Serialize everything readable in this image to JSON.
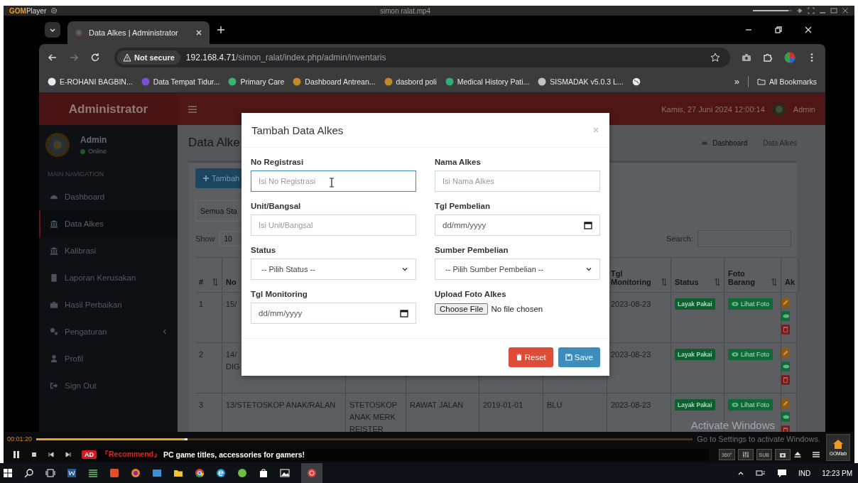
{
  "player": {
    "logo": "GOM",
    "name": "Player",
    "title": "simon ralat.mp4",
    "volume": {
      "level": 0.9
    }
  },
  "browser": {
    "tab_title": "Data Alkes | Administrator",
    "security": "Not secure",
    "host": "192.168.4.71",
    "path": "/simon_ralat/index.php/admin/inventaris",
    "bookmarks": [
      {
        "label": "E-ROHANI BAGBIN...",
        "color": "#e8eaed"
      },
      {
        "label": "Data Tempat Tidur...",
        "color": "#7b4fd6"
      },
      {
        "label": "Primary Care",
        "color": "#3cb371"
      },
      {
        "label": "Dashboard Antrean...",
        "color": "#c08a2b"
      },
      {
        "label": "dasbord poli",
        "color": "#c08a2b"
      },
      {
        "label": "Medical History Pati...",
        "color": "#2fae7a"
      },
      {
        "label": "SISMADAK v5.0.3 L...",
        "color": "#bfc3c8"
      }
    ],
    "overflow": "»",
    "all_bookmarks": "All Bookmarks"
  },
  "app": {
    "brand": "Administrator",
    "datetime": "Kamis, 27 Juni 2024 12:00:14",
    "user": "Admin",
    "sidebar": {
      "user": "Admin",
      "online": true,
      "status": "Online",
      "section": "MAIN NAVIGATION",
      "items": [
        {
          "label": "Dashboard",
          "selected": false,
          "submenu": false
        },
        {
          "label": "Data Alkes",
          "selected": true,
          "submenu": false
        },
        {
          "label": "Kalibrasi",
          "selected": false,
          "submenu": false
        },
        {
          "label": "Laporan Kerusakan",
          "selected": false,
          "submenu": false
        },
        {
          "label": "Hasil Perbaikan",
          "selected": false,
          "submenu": false
        },
        {
          "label": "Pengaturan",
          "selected": false,
          "submenu": true
        },
        {
          "label": "Profil",
          "selected": false,
          "submenu": false
        },
        {
          "label": "Sign Out",
          "selected": false,
          "submenu": false
        }
      ]
    },
    "page_title": "Data Alke",
    "breadcrumb": [
      "Dashboard",
      "Data Alkes"
    ],
    "add_button": "Tambah",
    "filter": "Semua Sta",
    "show_label": "Show",
    "show_value": "10",
    "search_label": "Search:",
    "table": {
      "columns": [
        "#",
        "No",
        null,
        null,
        null,
        null,
        "Tgl Monitoring",
        "Status",
        "Foto Barang",
        "Ak"
      ],
      "rows": [
        {
          "cells": [
            "1",
            "15/",
            null,
            null,
            null,
            null,
            "2023-08-23"
          ],
          "status": "Layak Pakai",
          "photo_button": "Lihat Foto"
        },
        {
          "cells": [
            "2",
            "14/\nDIG",
            null,
            null,
            null,
            null,
            "2023-08-23"
          ],
          "status": "Layak Pakai",
          "photo_button": "Lihat Foto"
        },
        {
          "cells": [
            "3",
            "13/STETOSKOP ANAK/RALAN",
            "STETOSKOP ANAK MERK REISTER",
            "RAWAT JALAN",
            "2019-01-01",
            "BLU",
            "2023-08-23"
          ],
          "status": "Layak Pakai",
          "photo_button": "Lihat Foto"
        }
      ]
    }
  },
  "modal": {
    "title": "Tambah Data Alkes",
    "fields": [
      {
        "kind": "text",
        "label": "No Registrasi",
        "placeholder": "Isi No Registrasi",
        "focused": true
      },
      {
        "kind": "text",
        "label": "Nama Alkes",
        "placeholder": "Isi Nama Alkes",
        "focused": false
      },
      {
        "kind": "text",
        "label": "Unit/Bangsal",
        "placeholder": "Isi Unit/Bangsal",
        "focused": false
      },
      {
        "kind": "date",
        "label": "Tgl Pembelian",
        "placeholder": "dd/mm/yyyy"
      },
      {
        "kind": "select",
        "label": "Status",
        "value": "-- Pilih Status --"
      },
      {
        "kind": "select",
        "label": "Sumber Pembelian",
        "value": "-- Pilih Sumber Pembelian --"
      },
      {
        "kind": "date",
        "label": "Tgl Monitoring",
        "placeholder": "dd/mm/yyyy"
      },
      {
        "kind": "file",
        "label": "Upload Foto Alkes",
        "button": "Choose File",
        "value": "No file chosen"
      }
    ],
    "buttons": [
      {
        "kind": "reset",
        "label": "Reset"
      },
      {
        "kind": "save",
        "label": "Save"
      }
    ]
  },
  "activation_notice": {
    "title": "Activate Windows",
    "subtitle": "Go to Settings to activate Windows."
  },
  "controls": {
    "time": "00:01:20",
    "seek": {
      "level": 0.23
    },
    "ad": "AD",
    "recommend": "『Recommend』",
    "ad_text": "PC game titles, accessories for gamers!",
    "vr": "360°",
    "sub": "SUB",
    "home_label": "GOMlab"
  },
  "taskbar": {
    "language": "IND",
    "time": "12:23 PM"
  }
}
